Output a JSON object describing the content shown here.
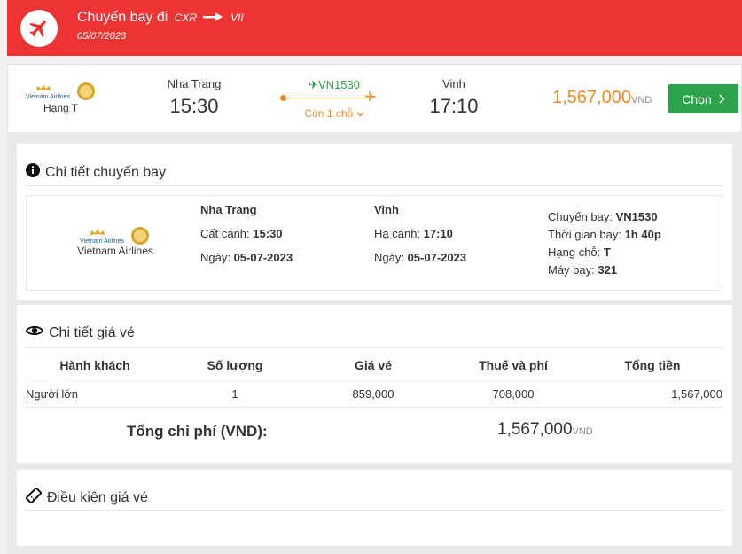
{
  "header": {
    "title": "Chuyến bay đi",
    "from_code": "CXR",
    "to_code": "VII",
    "date": "05/07/2023"
  },
  "flight_row": {
    "airline_logo_text": "Vietnam Airlines",
    "class_label": "Hạng T",
    "from_city": "Nha Trang",
    "depart_time": "15:30",
    "flight_no": "VN1530",
    "seats_left": "Còn 1 chỗ",
    "to_city": "Vinh",
    "arrive_time": "17:10",
    "price": "1,567,000",
    "currency": "VND",
    "select_button": "Chọn"
  },
  "flight_detail": {
    "title": "Chi tiết chuyến bay",
    "airline_name": "Vietnam Airlines",
    "logo_text": "Vietnam Airlines",
    "departure": {
      "city": "Nha Trang",
      "time_label": "Cất cánh: ",
      "time": "15:30",
      "date_label": "Ngày: ",
      "date": "05-07-2023"
    },
    "arrival": {
      "city": "Vinh",
      "time_label": "Hạ cánh: ",
      "time": "17:10",
      "date_label": "Ngày: ",
      "date": "05-07-2023"
    },
    "info": {
      "flight_label": "Chuyến bay: ",
      "flight": "VN1530",
      "duration_label": "Thời gian bay: ",
      "duration": "1h 40p",
      "class_label": "Hạng chỗ: ",
      "class": "T",
      "aircraft_label": "Máy bay: ",
      "aircraft": "321"
    }
  },
  "price_detail": {
    "title": "Chi tiết giá vé",
    "headers": [
      "Hành khách",
      "Số lượng",
      "Giá vé",
      "Thuế và phí",
      "Tổng tiền"
    ],
    "rows": [
      [
        "Người lớn",
        "1",
        "859,000",
        "708,000",
        "1,567,000"
      ]
    ],
    "total_label": "Tổng chi phí (VND):",
    "total_value": "1,567,000",
    "total_currency": "VND"
  },
  "conditions": {
    "title": "Điều kiện giá vé"
  },
  "colors": {
    "header_bg": "#ee3333",
    "accent_orange": "#f08a24",
    "button_green": "#2aa34a"
  },
  "icons": [
    "airplane-icon",
    "arrow-right-icon",
    "chevron-down-icon",
    "chevron-right-icon",
    "info-icon",
    "eye-icon",
    "ticket-icon"
  ]
}
